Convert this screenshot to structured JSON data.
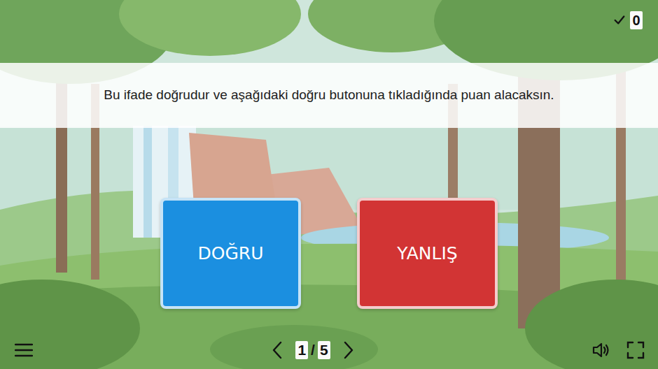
{
  "score": "0",
  "question": "Bu ifade doğrudur ve aşağıdaki doğru butonuna tıkladığında puan alacaksın.",
  "answers": [
    {
      "label": "DOĞRU",
      "color": "#1b8fe0"
    },
    {
      "label": "YANLIŞ",
      "color": "#d23434"
    }
  ],
  "pager": {
    "current": "1",
    "separator": "/",
    "total": "5"
  }
}
